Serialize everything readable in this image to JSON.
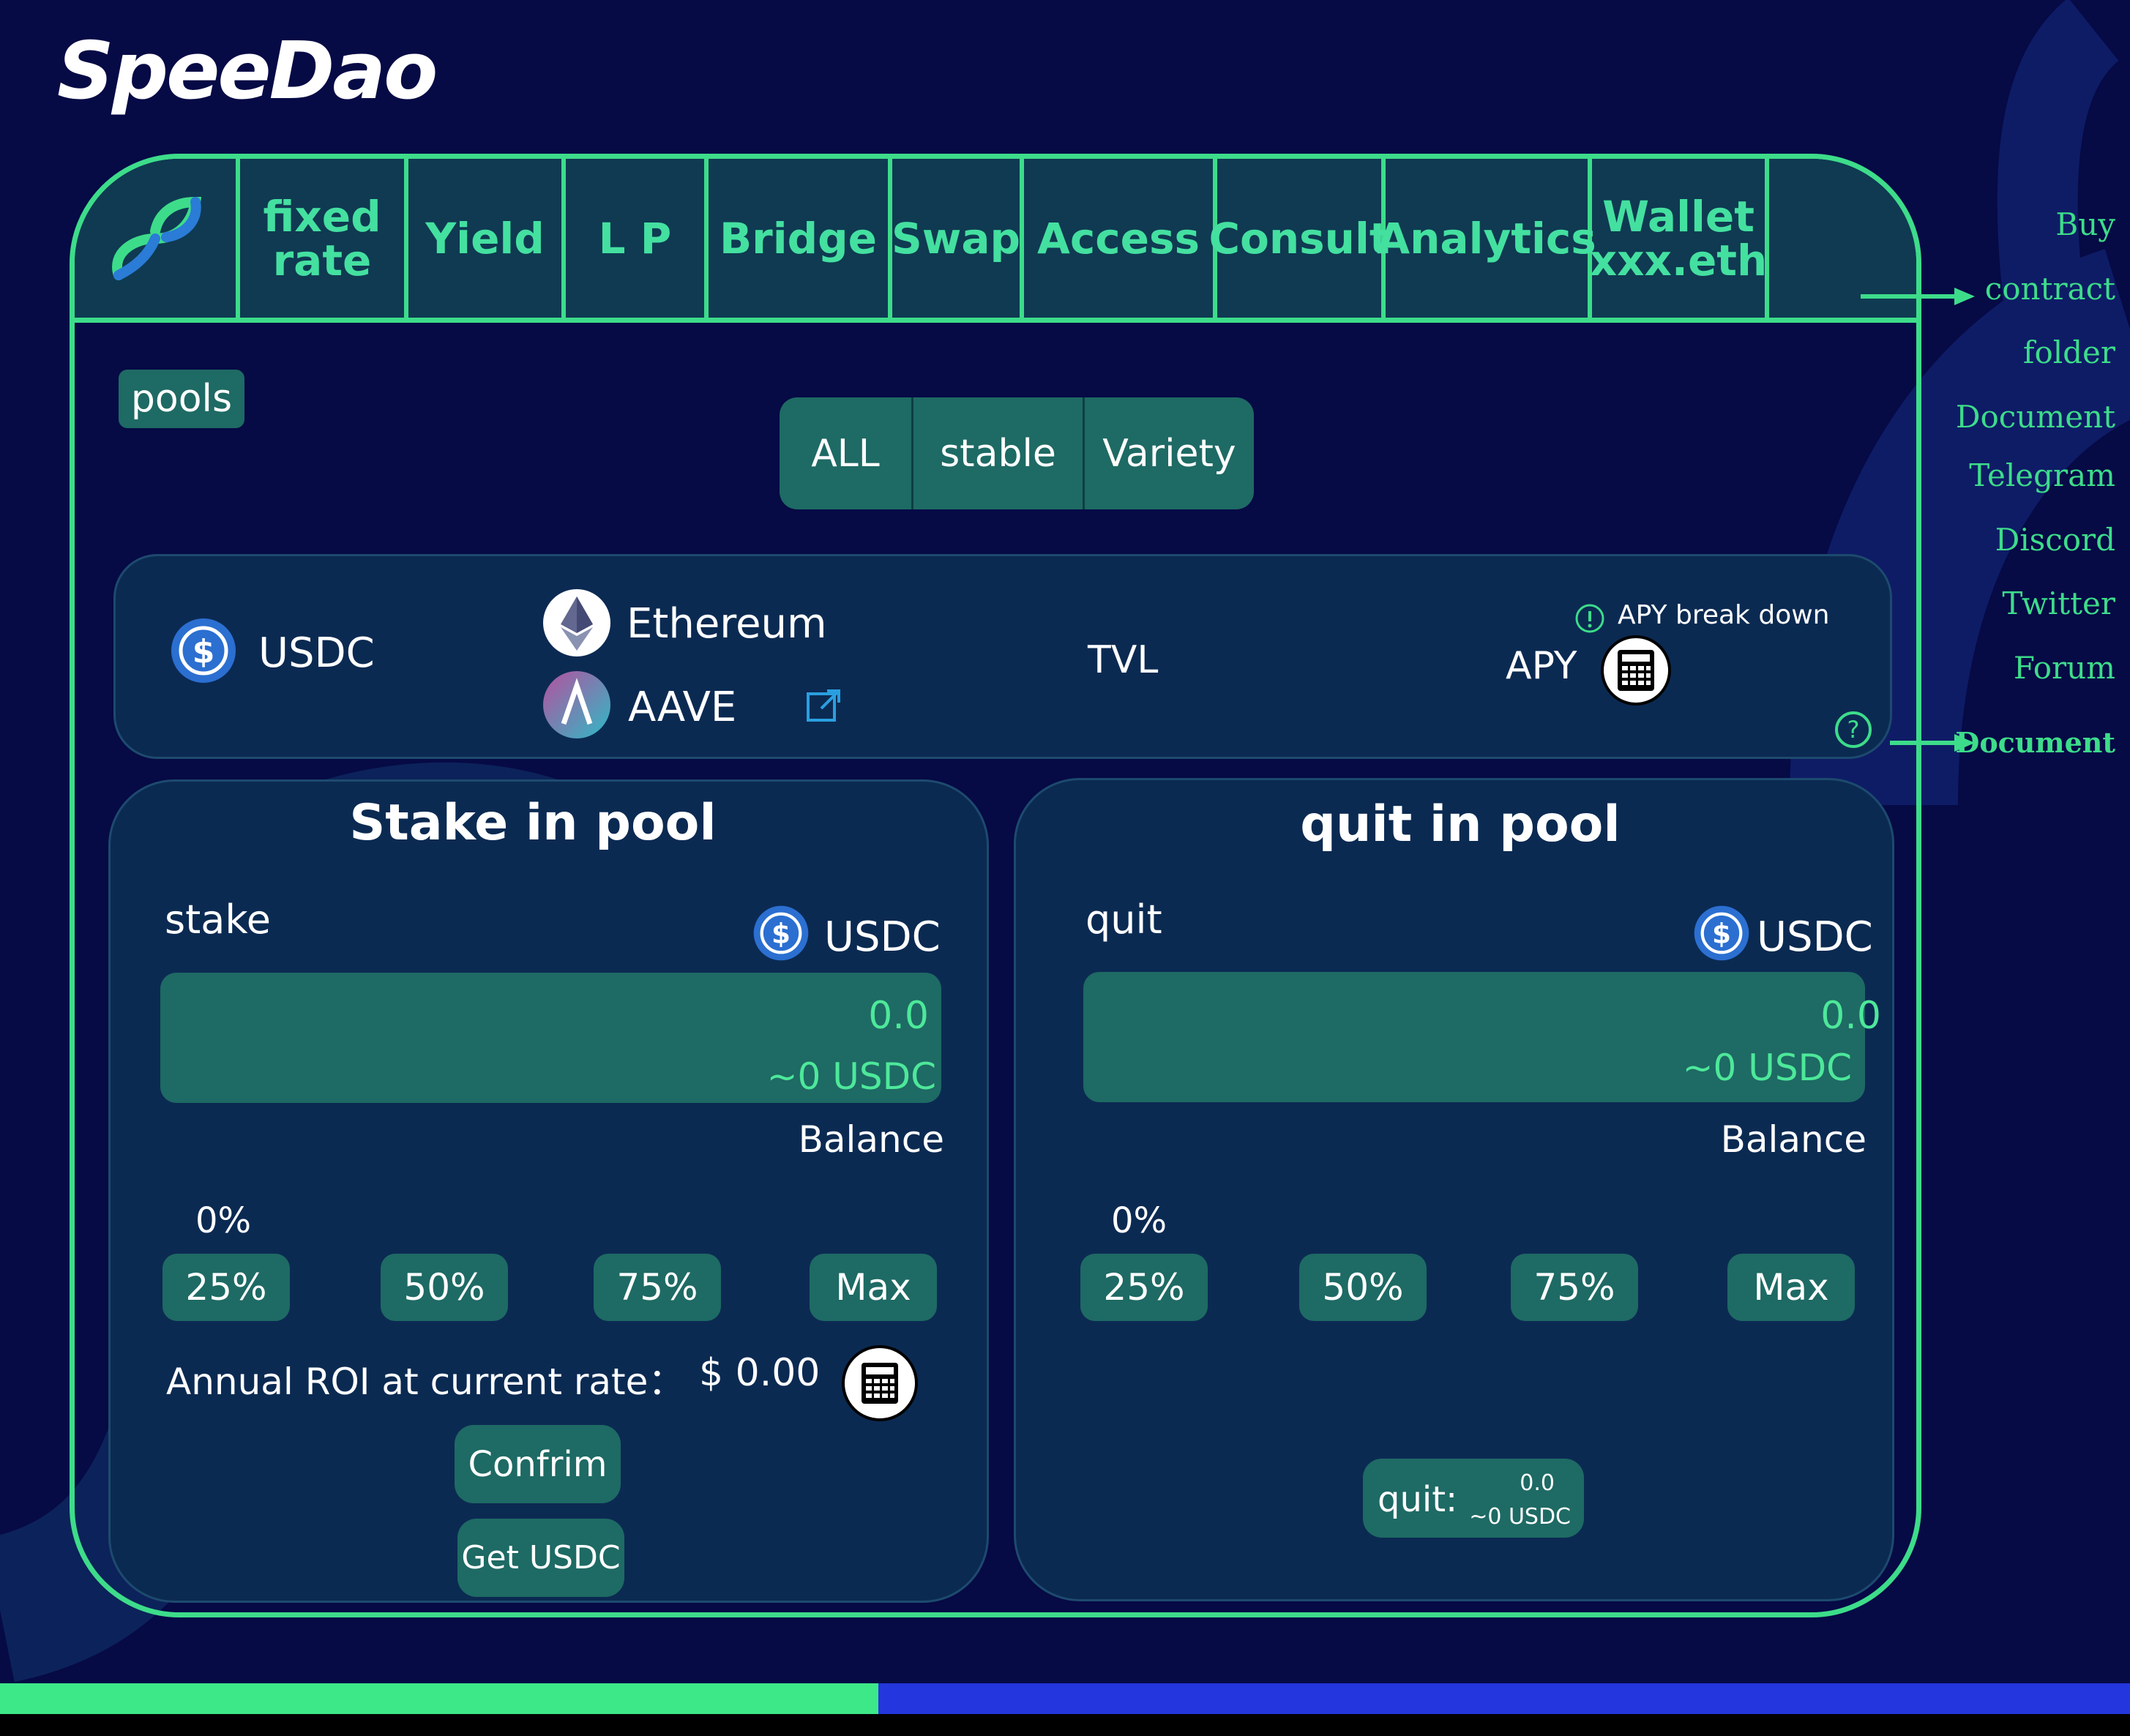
{
  "app": {
    "logo": "SpeeDao"
  },
  "nav": {
    "items": [
      {
        "label": "fixed\nrate"
      },
      {
        "label": "Yield"
      },
      {
        "label": "L P"
      },
      {
        "label": "Bridge"
      },
      {
        "label": "Swap"
      },
      {
        "label": "Access"
      },
      {
        "label": "Consult"
      },
      {
        "label": "Analytics"
      },
      {
        "label": "Wallet\nxxx.eth"
      }
    ]
  },
  "side_links": [
    "Buy",
    "contract",
    "folder",
    "Document",
    "Telegram",
    "Discord",
    "Twitter",
    "Forum",
    "Document"
  ],
  "pools_tag": "pools",
  "filters": [
    "ALL",
    "stable",
    "Variety"
  ],
  "pool_card": {
    "token": "USDC",
    "chain": "Ethereum",
    "protocol": "AAVE",
    "tvl_label": "TVL",
    "apy_label": "APY",
    "apy_breakdown": "APY break down"
  },
  "stake": {
    "title": "Stake in pool",
    "label": "stake",
    "token": "USDC",
    "amount": "0.0",
    "approx": "~0 USDC",
    "balance_label": "Balance",
    "percent": "0%",
    "buttons": [
      "25%",
      "50%",
      "75%",
      "Max"
    ],
    "roi_label": "Annual ROI at current rate：",
    "roi_value": "$ 0.00",
    "confirm": "Confrim",
    "get_usdc": "Get USDC"
  },
  "quit": {
    "title": "quit in pool",
    "label": "quit",
    "token": "USDC",
    "amount": "0.0",
    "approx": "~0 USDC",
    "balance_label": "Balance",
    "percent": "0%",
    "buttons": [
      "25%",
      "50%",
      "75%",
      "Max"
    ],
    "quit_button_label": "quit:",
    "quit_button_amount": "0.0",
    "quit_button_approx": "~0 USDC"
  },
  "colors": {
    "background": "#060a45",
    "accent": "#3ddc8a",
    "panel": "#0b2a52",
    "button": "#1e6a64",
    "bar_blue": "#2436dd"
  }
}
